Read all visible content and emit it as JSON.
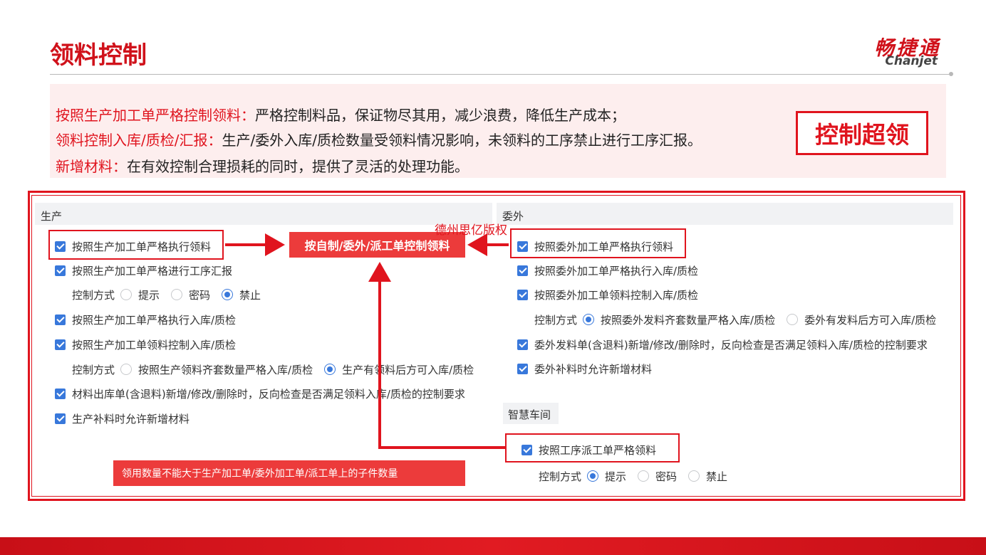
{
  "page": {
    "title": "领料控制",
    "logo_cn": "畅捷通",
    "logo_en": "Chanjet"
  },
  "description": {
    "lines": [
      {
        "key": "按照生产加工单严格控制领料：",
        "text": "严格控制料品，保证物尽其用，减少浪费，降低生产成本；"
      },
      {
        "key": "领料控制入库/质检/汇报：",
        "text": "生产/委外入库/质检数量受领料情况影响，未领料的工序禁止进行工序汇报。"
      },
      {
        "key": "新增材料：",
        "text": "在有效控制合理损耗的同时，提供了灵活的处理功能。"
      }
    ],
    "badge": "控制超领"
  },
  "production": {
    "header": "生产",
    "items": [
      "按照生产加工单严格执行领料",
      "按照生产加工单严格进行工序汇报",
      "按照生产加工单严格执行入库/质检",
      "按照生产加工单领料控制入库/质检",
      "材料出库单(含退料)新增/修改/删除时，反向检查是否满足领料入库/质检的控制要求",
      "生产补料时允许新增材料"
    ],
    "control_label": "控制方式",
    "report_options": [
      "提示",
      "密码",
      "禁止"
    ],
    "report_selected": 2,
    "inbound_options": [
      "按照生产领料齐套数量严格入库/质检",
      "生产有领料后方可入库/质检"
    ],
    "inbound_selected": 1
  },
  "outsourcing": {
    "header": "委外",
    "items": [
      "按照委外加工单严格执行领料",
      "按照委外加工单严格执行入库/质检",
      "按照委外加工单领料控制入库/质检",
      "委外发料单(含退料)新增/修改/删除时，反向检查是否满足领料入库/质检的控制要求",
      "委外补料时允许新增材料"
    ],
    "control_label": "控制方式",
    "inbound_options": [
      "按照委外发料齐套数量严格入库/质检",
      "委外有发料后方可入库/质检"
    ],
    "inbound_selected": 0
  },
  "workshop": {
    "header": "智慧车间",
    "item": "按照工序派工单严格领料",
    "control_label": "控制方式",
    "options": [
      "提示",
      "密码",
      "禁止"
    ],
    "selected": 0
  },
  "callouts": {
    "center": "按自制/委外/派工单控制领料",
    "note": "领用数量不能大于生产加工单/委外加工单/派工单上的子件数量",
    "watermark": "德州思亿版权"
  },
  "colors": {
    "brand_red": "#e0141e",
    "checkbox_blue": "#3878db",
    "callout_red": "#ec3b3b"
  }
}
